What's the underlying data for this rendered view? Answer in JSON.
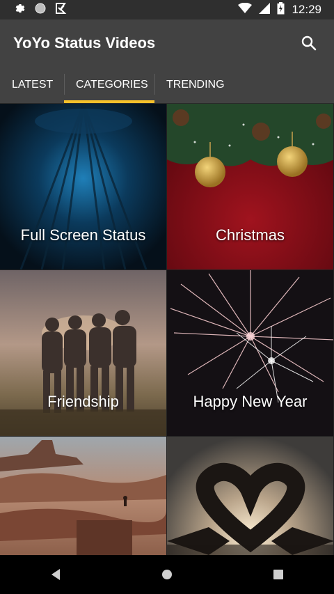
{
  "status_bar": {
    "time": "12:29",
    "left_icons": [
      "gear-icon",
      "circle-icon",
      "download-icon"
    ],
    "right_icons": [
      "wifi-icon",
      "signal-icon",
      "battery-icon"
    ]
  },
  "app_bar": {
    "title": "YoYo Status Videos",
    "search_icon": "search-icon"
  },
  "tabs": [
    {
      "label": "LATEST",
      "active": false
    },
    {
      "label": "CATEGORIES",
      "active": true
    },
    {
      "label": "TRENDING",
      "active": false
    }
  ],
  "categories": [
    {
      "label": "Full Screen Status"
    },
    {
      "label": "Christmas"
    },
    {
      "label": "Friendship"
    },
    {
      "label": "Happy New Year"
    },
    {
      "label": ""
    },
    {
      "label": ""
    }
  ],
  "colors": {
    "accent": "#f5c02b",
    "toolbar": "#424242",
    "status_bar": "#2f2f2f",
    "nav_bar": "#000000"
  },
  "nav_bar": {
    "icons": [
      "back-icon",
      "home-icon",
      "recents-icon"
    ]
  }
}
